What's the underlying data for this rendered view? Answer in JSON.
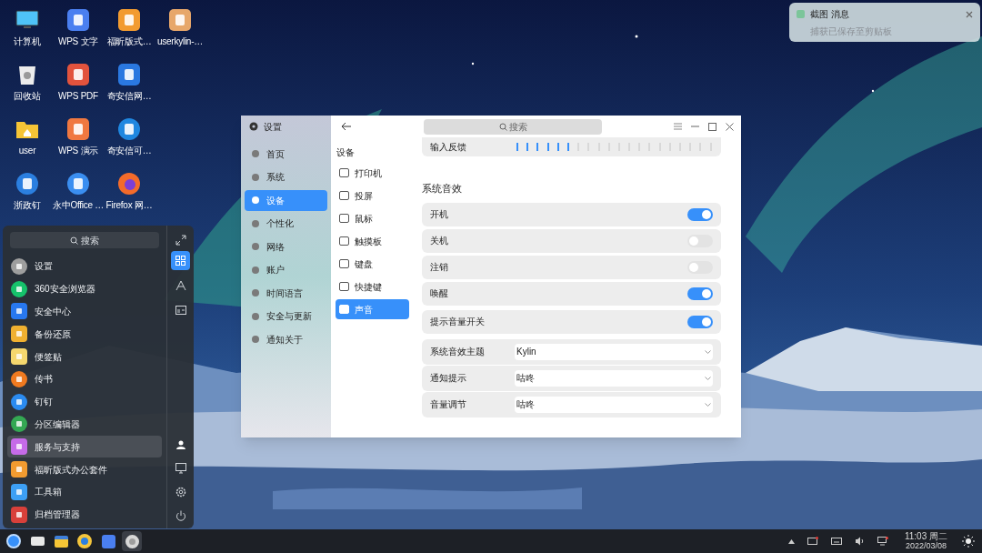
{
  "notification": {
    "title": "截图 消息",
    "body": "捕获已保存至剪贴板"
  },
  "desktop_rows": [
    [
      {
        "label": "计算机"
      },
      {
        "label": "WPS 文字"
      },
      {
        "label": "福昕版式…"
      },
      {
        "label": "userkylin-…"
      }
    ],
    [
      {
        "label": "回收站"
      },
      {
        "label": "WPS PDF"
      },
      {
        "label": "奇安信网…"
      }
    ],
    [
      {
        "label": "user"
      },
      {
        "label": "WPS 演示"
      },
      {
        "label": "奇安信可…"
      }
    ],
    [
      {
        "label": "浙政钉"
      },
      {
        "label": "永中Office …"
      },
      {
        "label": "Firefox 网…"
      }
    ]
  ],
  "start_menu": {
    "search": {
      "placeholder": "搜索"
    },
    "apps": [
      {
        "label": "设置",
        "selected": false
      },
      {
        "label": "360安全浏览器",
        "selected": false
      },
      {
        "label": "安全中心",
        "selected": false
      },
      {
        "label": "备份还原",
        "selected": false
      },
      {
        "label": "便签贴",
        "selected": false
      },
      {
        "label": "传书",
        "selected": false
      },
      {
        "label": "钉钉",
        "selected": false
      },
      {
        "label": "分区编辑器",
        "selected": false
      },
      {
        "label": "服务与支持",
        "selected": true
      },
      {
        "label": "福昕版式办公套件",
        "selected": false
      },
      {
        "label": "工具箱",
        "selected": false
      },
      {
        "label": "归档管理器",
        "selected": false
      }
    ],
    "view_modes": [
      {
        "selected": true
      },
      {
        "selected": false
      },
      {
        "selected": false
      }
    ]
  },
  "settings": {
    "title": "设置",
    "search": {
      "placeholder": "搜索"
    },
    "nav": [
      {
        "label": "首页",
        "selected": false
      },
      {
        "label": "系统",
        "selected": false
      },
      {
        "label": "设备",
        "selected": true
      },
      {
        "label": "个性化",
        "selected": false
      },
      {
        "label": "网络",
        "selected": false
      },
      {
        "label": "账户",
        "selected": false
      },
      {
        "label": "时间语言",
        "selected": false
      },
      {
        "label": "安全与更新",
        "selected": false
      },
      {
        "label": "通知关于",
        "selected": false
      }
    ],
    "devices_title": "设备",
    "devices": [
      {
        "label": "打印机",
        "selected": false
      },
      {
        "label": "投屏",
        "selected": false
      },
      {
        "label": "鼠标",
        "selected": false
      },
      {
        "label": "触摸板",
        "selected": false
      },
      {
        "label": "键盘",
        "selected": false
      },
      {
        "label": "快捷键",
        "selected": false
      },
      {
        "label": "声音",
        "selected": true
      }
    ],
    "feedback": {
      "label": "输入反馈",
      "level": 0.3
    },
    "section_title": "系统音效",
    "switches": [
      {
        "label": "开机",
        "on": true
      },
      {
        "label": "关机",
        "on": false
      },
      {
        "label": "注销",
        "on": false
      },
      {
        "label": "唤醒",
        "on": true
      },
      {
        "label": "提示音量开关",
        "on": true
      }
    ],
    "dropdowns": [
      {
        "label": "系统音效主题",
        "value": "Kylin"
      },
      {
        "label": "通知提示",
        "value": "咕咚"
      },
      {
        "label": "音量调节",
        "value": "咕咚"
      }
    ]
  },
  "taskbar": {
    "apps": [
      {
        "selected": false
      },
      {
        "selected": false
      },
      {
        "selected": false
      },
      {
        "selected": false
      },
      {
        "selected": false
      },
      {
        "selected": true
      }
    ],
    "time": "11:03 周二",
    "date": "2022/03/08"
  }
}
